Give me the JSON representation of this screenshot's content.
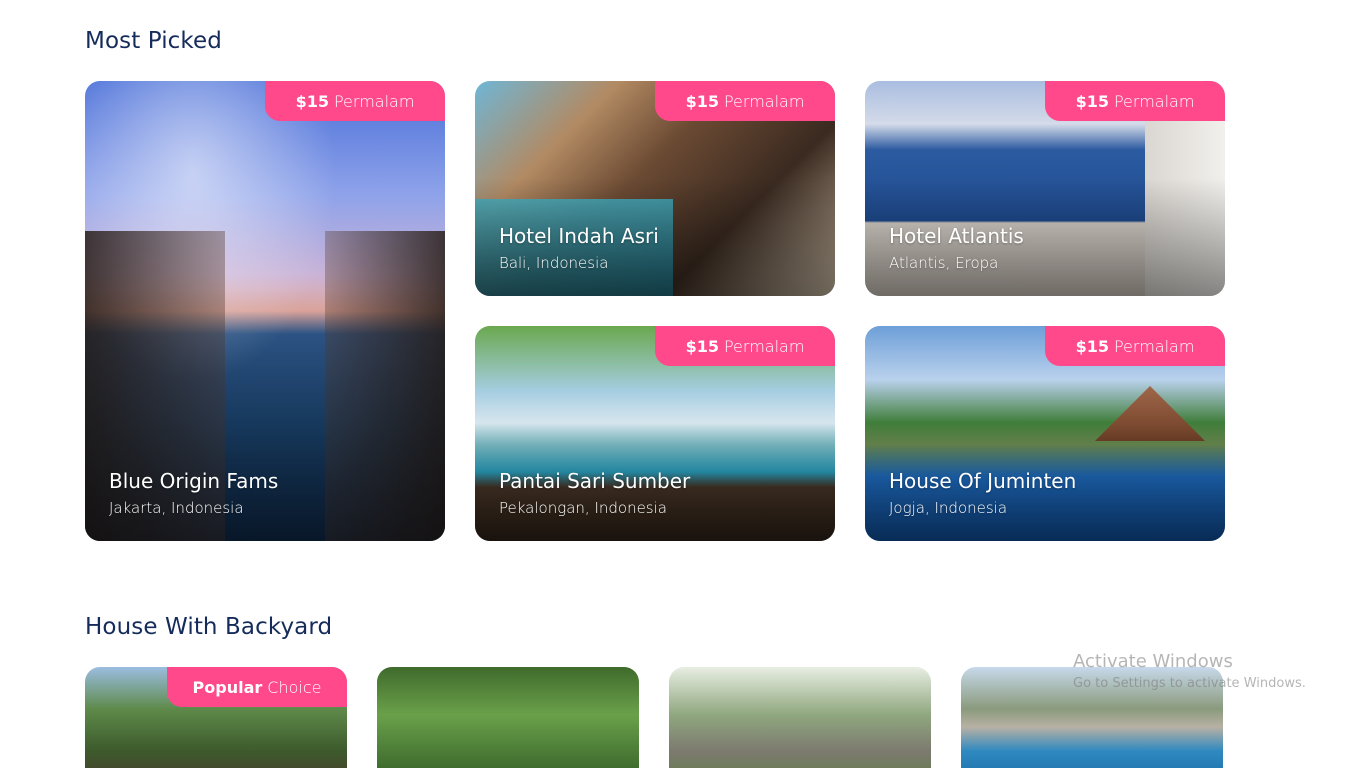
{
  "sections": {
    "most_picked_title": "Most Picked",
    "backyard_title": "House With Backyard"
  },
  "most_picked": [
    {
      "price": "$15",
      "per": "Permalam",
      "name": "Blue Origin Fams",
      "location": "Jakarta, Indonesia"
    },
    {
      "price": "$15",
      "per": "Permalam",
      "name": "Hotel Indah Asri",
      "location": "Bali, Indonesia"
    },
    {
      "price": "$15",
      "per": "Permalam",
      "name": "Hotel Atlantis",
      "location": "Atlantis, Eropa"
    },
    {
      "price": "$15",
      "per": "Permalam",
      "name": "Pantai Sari Sumber",
      "location": "Pekalongan, Indonesia"
    },
    {
      "price": "$15",
      "per": "Permalam",
      "name": "House Of Juminten",
      "location": "Jogja, Indonesia"
    }
  ],
  "backyard": {
    "badge_strong": "Popular",
    "badge_light": "Choice"
  },
  "watermark": {
    "title": "Activate Windows",
    "subtitle": "Go to Settings to activate Windows."
  },
  "colors": {
    "heading": "#152c5b",
    "badge": "#ff498b"
  }
}
